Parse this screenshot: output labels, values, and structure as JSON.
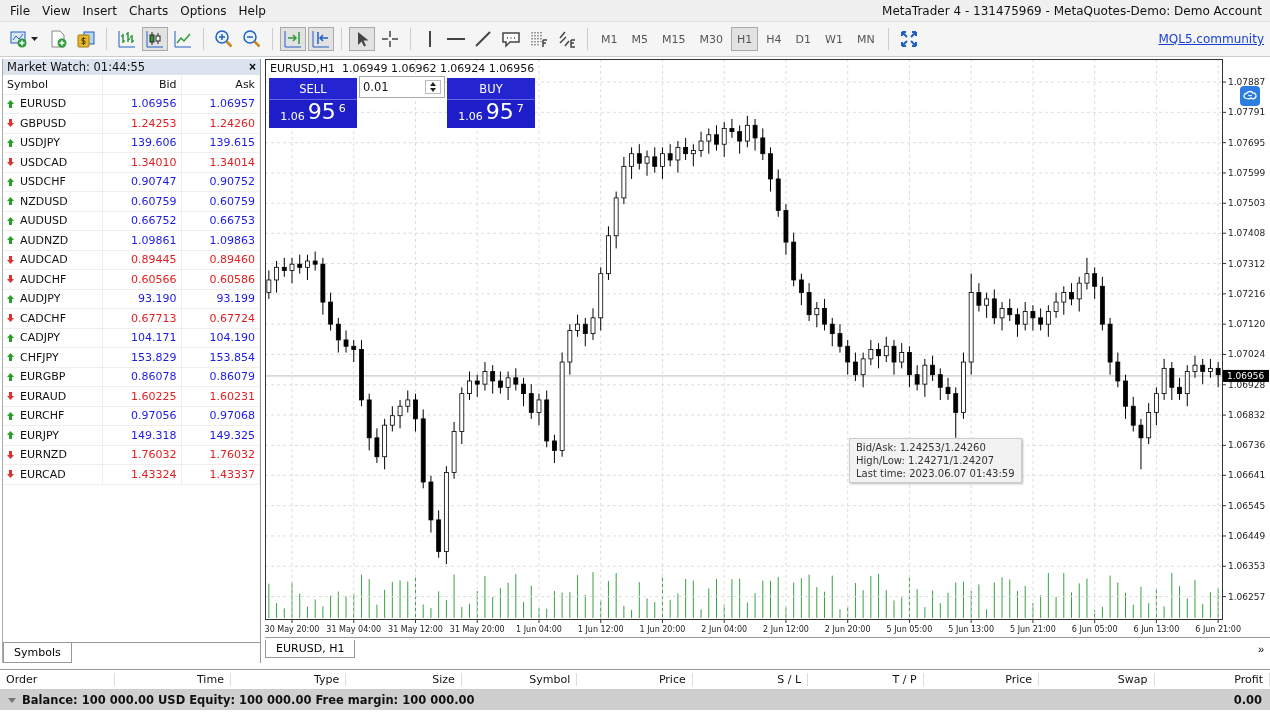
{
  "menu": [
    "File",
    "View",
    "Insert",
    "Charts",
    "Options",
    "Help"
  ],
  "window": {
    "title": "MetaTrader 4 - 131475969 - MetaQuotes-Demo: Demo Account"
  },
  "toolbar": {
    "groups": [
      {
        "tools": [
          {
            "kind": "new-chart",
            "selected": false
          },
          {
            "kind": "new-document",
            "selected": false
          },
          {
            "kind": "dollar-windows",
            "selected": false
          }
        ]
      },
      {
        "tools": [
          {
            "kind": "bar-chart",
            "selected": false
          },
          {
            "kind": "candle-chart",
            "selected": true
          },
          {
            "kind": "line-chart",
            "selected": false
          }
        ]
      },
      {
        "tools": [
          {
            "kind": "zoom-in",
            "selected": false
          },
          {
            "kind": "zoom-out",
            "selected": false
          }
        ]
      },
      {
        "tools": [
          {
            "kind": "auto-scroll",
            "selected": true
          },
          {
            "kind": "chart-shift",
            "selected": true
          }
        ]
      },
      {
        "tools": [
          {
            "kind": "cursor",
            "selected": true
          },
          {
            "kind": "crosshair",
            "selected": false
          }
        ]
      },
      {
        "tools": [
          {
            "kind": "vertical-line",
            "selected": false
          },
          {
            "kind": "horizontal-line",
            "selected": false
          },
          {
            "kind": "trend-line",
            "selected": false
          },
          {
            "kind": "text-label",
            "selected": false
          },
          {
            "kind": "fibonacci",
            "selected": false
          },
          {
            "kind": "fib-expansion",
            "selected": false
          }
        ]
      }
    ],
    "timeframes": [
      {
        "label": "M1",
        "selected": false
      },
      {
        "label": "M5",
        "selected": false
      },
      {
        "label": "M15",
        "selected": false
      },
      {
        "label": "M30",
        "selected": false
      },
      {
        "label": "H1",
        "selected": true
      },
      {
        "label": "H4",
        "selected": false
      },
      {
        "label": "D1",
        "selected": false
      },
      {
        "label": "W1",
        "selected": false
      },
      {
        "label": "MN",
        "selected": false
      }
    ],
    "link": "MQL5.community"
  },
  "market_watch": {
    "title": "Market Watch: 01:44:55",
    "close": "×",
    "columns": [
      "Symbol",
      "Bid",
      "Ask"
    ],
    "rows": [
      {
        "symbol": "EURUSD",
        "bid": "1.06956",
        "ask": "1.06957",
        "rising": true
      },
      {
        "symbol": "GBPUSD",
        "bid": "1.24253",
        "ask": "1.24260",
        "rising": false
      },
      {
        "symbol": "USDJPY",
        "bid": "139.606",
        "ask": "139.615",
        "rising": true
      },
      {
        "symbol": "USDCAD",
        "bid": "1.34010",
        "ask": "1.34014",
        "rising": false
      },
      {
        "symbol": "USDCHF",
        "bid": "0.90747",
        "ask": "0.90752",
        "rising": true
      },
      {
        "symbol": "NZDUSD",
        "bid": "0.60759",
        "ask": "0.60759",
        "rising": true
      },
      {
        "symbol": "AUDUSD",
        "bid": "0.66752",
        "ask": "0.66753",
        "rising": true
      },
      {
        "symbol": "AUDNZD",
        "bid": "1.09861",
        "ask": "1.09863",
        "rising": true
      },
      {
        "symbol": "AUDCAD",
        "bid": "0.89445",
        "ask": "0.89460",
        "rising": false
      },
      {
        "symbol": "AUDCHF",
        "bid": "0.60566",
        "ask": "0.60586",
        "rising": false
      },
      {
        "symbol": "AUDJPY",
        "bid": "93.190",
        "ask": "93.199",
        "rising": true
      },
      {
        "symbol": "CADCHF",
        "bid": "0.67713",
        "ask": "0.67724",
        "rising": false
      },
      {
        "symbol": "CADJPY",
        "bid": "104.171",
        "ask": "104.190",
        "rising": true
      },
      {
        "symbol": "CHFJPY",
        "bid": "153.829",
        "ask": "153.854",
        "rising": true
      },
      {
        "symbol": "EURGBP",
        "bid": "0.86078",
        "ask": "0.86079",
        "rising": true
      },
      {
        "symbol": "EURAUD",
        "bid": "1.60225",
        "ask": "1.60231",
        "rising": false
      },
      {
        "symbol": "EURCHF",
        "bid": "0.97056",
        "ask": "0.97068",
        "rising": true
      },
      {
        "symbol": "EURJPY",
        "bid": "149.318",
        "ask": "149.325",
        "rising": true
      },
      {
        "symbol": "EURNZD",
        "bid": "1.76032",
        "ask": "1.76032",
        "rising": false
      },
      {
        "symbol": "EURCAD",
        "bid": "1.43324",
        "ask": "1.43337",
        "rising": false
      }
    ],
    "tabs": [
      {
        "label": "Symbols",
        "selected": true
      }
    ]
  },
  "chart": {
    "header": "EURUSD,H1  1.06949 1.06962 1.06924 1.06956",
    "trade_panel": {
      "sell": "SELL",
      "buy": "BUY",
      "lot": "0.01",
      "sell_price": [
        "1.06",
        "95",
        "6"
      ],
      "buy_price": [
        "1.06",
        "95",
        "7"
      ]
    },
    "current_price": "1.06956",
    "tooltip": [
      "Bid/Ask: 1.24253/1.24260",
      "High/Low: 1.24271/1.24207",
      "Last time: 2023.06.07 01:43:59"
    ],
    "tabs": [
      {
        "label": "EURUSD, H1",
        "selected": true
      }
    ],
    "more": "»",
    "chart_data": {
      "type": "candlestick",
      "grid": true,
      "categories": [
        null,
        null,
        null,
        "30 May 20:00",
        null,
        null,
        null,
        null,
        null,
        null,
        null,
        "31 May 04:00",
        null,
        null,
        null,
        null,
        null,
        null,
        null,
        "31 May 12:00",
        null,
        null,
        null,
        null,
        null,
        null,
        null,
        "31 May 20:00",
        null,
        null,
        null,
        null,
        null,
        null,
        null,
        "1 Jun 04:00",
        null,
        null,
        null,
        null,
        null,
        null,
        null,
        "1 Jun 12:00",
        null,
        null,
        null,
        null,
        null,
        null,
        null,
        "1 Jun 20:00",
        null,
        null,
        null,
        null,
        null,
        null,
        null,
        "2 Jun 04:00",
        null,
        null,
        null,
        null,
        null,
        null,
        null,
        "2 Jun 12:00",
        null,
        null,
        null,
        null,
        null,
        null,
        null,
        "2 Jun 20:00",
        null,
        null,
        null,
        null,
        null,
        null,
        null,
        "5 Jun 05:00",
        null,
        null,
        null,
        null,
        null,
        null,
        null,
        "5 Jun 13:00",
        null,
        null,
        null,
        null,
        null,
        null,
        null,
        "5 Jun 21:00",
        null,
        null,
        null,
        null,
        null,
        null,
        null,
        "6 Jun 05:00",
        null,
        null,
        null,
        null,
        null,
        null,
        null,
        "6 Jun 13:00",
        null,
        null,
        null,
        null,
        null,
        null,
        null,
        "6 Jun 21:00"
      ],
      "ref_lines": [
        {
          "axis": "y",
          "value": 1.06956
        }
      ],
      "ylim": [
        1.06186,
        1.0796
      ],
      "yticks": [
        {
          "value": 1.07887,
          "label": "1.07887"
        },
        {
          "value": 1.07791,
          "label": "1.07791"
        },
        {
          "value": 1.07695,
          "label": "1.07695"
        },
        {
          "value": 1.07599,
          "label": "1.07599"
        },
        {
          "value": 1.07503,
          "label": "1.07503"
        },
        {
          "value": 1.07408,
          "label": "1.07408"
        },
        {
          "value": 1.07312,
          "label": "1.07312"
        },
        {
          "value": 1.07216,
          "label": "1.07216"
        },
        {
          "value": 1.0712,
          "label": "1.07120"
        },
        {
          "value": 1.07024,
          "label": "1.07024"
        },
        {
          "value": 1.06928,
          "label": "1.06928"
        },
        {
          "value": 1.06832,
          "label": "1.06832"
        },
        {
          "value": 1.06736,
          "label": "1.06736"
        },
        {
          "value": 1.06641,
          "label": "1.06641"
        },
        {
          "value": 1.06545,
          "label": "1.06545"
        },
        {
          "value": 1.06449,
          "label": "1.06449"
        },
        {
          "value": 1.06353,
          "label": "1.06353"
        },
        {
          "value": 1.06257,
          "label": "1.06257"
        }
      ],
      "ohlc": [
        [
          1.0722,
          1.0729,
          1.072,
          1.0726
        ],
        [
          1.0726,
          1.0732,
          1.0722,
          1.073
        ],
        [
          1.073,
          1.0733,
          1.0727,
          1.0729
        ],
        [
          1.0729,
          1.0733,
          1.0725,
          1.0731
        ],
        [
          1.0731,
          1.0734,
          1.0728,
          1.073
        ],
        [
          1.073,
          1.0734,
          1.0726,
          1.0732
        ],
        [
          1.0732,
          1.0735,
          1.0729,
          1.0731
        ],
        [
          1.0731,
          1.0733,
          1.0715,
          1.0719
        ],
        [
          1.0719,
          1.0722,
          1.071,
          1.0712
        ],
        [
          1.0712,
          1.0714,
          1.0703,
          1.0707
        ],
        [
          1.0707,
          1.071,
          1.0703,
          1.0705
        ],
        [
          1.0705,
          1.0707,
          1.07,
          1.0704
        ],
        [
          1.0704,
          1.0707,
          1.0686,
          1.0688
        ],
        [
          1.0688,
          1.069,
          1.0672,
          1.0676
        ],
        [
          1.0676,
          1.0679,
          1.0668,
          1.067
        ],
        [
          1.067,
          1.0682,
          1.0666,
          1.068
        ],
        [
          1.068,
          1.0686,
          1.0678,
          1.0683
        ],
        [
          1.0683,
          1.0688,
          1.0679,
          1.0686
        ],
        [
          1.0686,
          1.0691,
          1.0684,
          1.0688
        ],
        [
          1.0688,
          1.069,
          1.0678,
          1.0682
        ],
        [
          1.0682,
          1.0685,
          1.066,
          1.0662
        ],
        [
          1.0662,
          1.0664,
          1.0646,
          1.065
        ],
        [
          1.065,
          1.0653,
          1.0638,
          1.064
        ],
        [
          1.064,
          1.0667,
          1.0636,
          1.0665
        ],
        [
          1.0665,
          1.0681,
          1.0663,
          1.0678
        ],
        [
          1.0678,
          1.0692,
          1.0674,
          1.069
        ],
        [
          1.069,
          1.0697,
          1.0688,
          1.0694
        ],
        [
          1.0694,
          1.0696,
          1.0689,
          1.0693
        ],
        [
          1.0693,
          1.07,
          1.0691,
          1.0697
        ],
        [
          1.0697,
          1.0699,
          1.069,
          1.0694
        ],
        [
          1.0694,
          1.0697,
          1.069,
          1.0692
        ],
        [
          1.0692,
          1.0697,
          1.0688,
          1.0695
        ],
        [
          1.0695,
          1.0698,
          1.0691,
          1.0693
        ],
        [
          1.0693,
          1.0695,
          1.0686,
          1.069
        ],
        [
          1.069,
          1.0693,
          1.0682,
          1.0684
        ],
        [
          1.0684,
          1.069,
          1.068,
          1.0688
        ],
        [
          1.0688,
          1.0691,
          1.0673,
          1.0675
        ],
        [
          1.0675,
          1.0677,
          1.0668,
          1.0672
        ],
        [
          1.0672,
          1.0703,
          1.067,
          1.07
        ],
        [
          1.07,
          1.0712,
          1.0696,
          1.071
        ],
        [
          1.071,
          1.0715,
          1.0708,
          1.0712
        ],
        [
          1.0712,
          1.0714,
          1.0705,
          1.0709
        ],
        [
          1.0709,
          1.0717,
          1.0707,
          1.0714
        ],
        [
          1.0714,
          1.073,
          1.071,
          1.0728
        ],
        [
          1.0728,
          1.0743,
          1.0726,
          1.074
        ],
        [
          1.074,
          1.0754,
          1.0736,
          1.0752
        ],
        [
          1.0752,
          1.0765,
          1.075,
          1.0762
        ],
        [
          1.0762,
          1.0768,
          1.0758,
          1.0766
        ],
        [
          1.0766,
          1.0769,
          1.0761,
          1.0763
        ],
        [
          1.0763,
          1.0767,
          1.0759,
          1.0765
        ],
        [
          1.0765,
          1.0768,
          1.076,
          1.0762
        ],
        [
          1.0762,
          1.0768,
          1.0758,
          1.0766
        ],
        [
          1.0766,
          1.0769,
          1.0762,
          1.0764
        ],
        [
          1.0764,
          1.077,
          1.076,
          1.0768
        ],
        [
          1.0768,
          1.0771,
          1.0764,
          1.0766
        ],
        [
          1.0766,
          1.0769,
          1.0762,
          1.0767
        ],
        [
          1.0767,
          1.0773,
          1.0765,
          1.077
        ],
        [
          1.077,
          1.0774,
          1.0766,
          1.0772
        ],
        [
          1.0772,
          1.0775,
          1.0767,
          1.0769
        ],
        [
          1.0769,
          1.0776,
          1.0765,
          1.0774
        ],
        [
          1.0774,
          1.0777,
          1.0771,
          1.0773
        ],
        [
          1.0773,
          1.0775,
          1.0766,
          1.077
        ],
        [
          1.077,
          1.0778,
          1.0768,
          1.0775
        ],
        [
          1.0775,
          1.0777,
          1.0767,
          1.0771
        ],
        [
          1.0771,
          1.0774,
          1.0764,
          1.0766
        ],
        [
          1.0766,
          1.0768,
          1.0754,
          1.0758
        ],
        [
          1.0758,
          1.0761,
          1.0746,
          1.0748
        ],
        [
          1.0748,
          1.075,
          1.0734,
          1.0738
        ],
        [
          1.0738,
          1.0741,
          1.0724,
          1.0726
        ],
        [
          1.0726,
          1.0728,
          1.0718,
          1.0722
        ],
        [
          1.0722,
          1.0725,
          1.0713,
          1.0715
        ],
        [
          1.0715,
          1.0719,
          1.0711,
          1.0717
        ],
        [
          1.0717,
          1.072,
          1.071,
          1.0712
        ],
        [
          1.0712,
          1.0714,
          1.0705,
          1.0709
        ],
        [
          1.0709,
          1.0712,
          1.0703,
          1.0705
        ],
        [
          1.0705,
          1.0707,
          1.0696,
          1.07
        ],
        [
          1.07,
          1.0703,
          1.0694,
          1.0696
        ],
        [
          1.0696,
          1.0703,
          1.0692,
          1.0701
        ],
        [
          1.0701,
          1.0707,
          1.0699,
          1.0704
        ],
        [
          1.0704,
          1.0706,
          1.0698,
          1.0702
        ],
        [
          1.0702,
          1.0708,
          1.07,
          1.0705
        ],
        [
          1.0705,
          1.0707,
          1.0696,
          1.07
        ],
        [
          1.07,
          1.0706,
          1.0698,
          1.0703
        ],
        [
          1.0703,
          1.0705,
          1.0692,
          1.0696
        ],
        [
          1.0696,
          1.0699,
          1.0691,
          1.0693
        ],
        [
          1.0693,
          1.0701,
          1.0689,
          1.0699
        ],
        [
          1.0699,
          1.0702,
          1.0694,
          1.0696
        ],
        [
          1.0696,
          1.0698,
          1.0688,
          1.0692
        ],
        [
          1.0692,
          1.0695,
          1.0688,
          1.069
        ],
        [
          1.069,
          1.0692,
          1.0676,
          1.0684
        ],
        [
          1.0684,
          1.0703,
          1.0682,
          1.07
        ],
        [
          1.07,
          1.0728,
          1.0696,
          1.0722
        ],
        [
          1.0722,
          1.0725,
          1.0716,
          1.0718
        ],
        [
          1.0718,
          1.0722,
          1.0714,
          1.072
        ],
        [
          1.072,
          1.0723,
          1.0712,
          1.0714
        ],
        [
          1.0714,
          1.0719,
          1.071,
          1.0717
        ],
        [
          1.0717,
          1.072,
          1.0713,
          1.0715
        ],
        [
          1.0715,
          1.0717,
          1.0708,
          1.0712
        ],
        [
          1.0712,
          1.0719,
          1.071,
          1.0716
        ],
        [
          1.0716,
          1.0718,
          1.071,
          1.0714
        ],
        [
          1.0714,
          1.0717,
          1.071,
          1.0712
        ],
        [
          1.0712,
          1.0718,
          1.0708,
          1.0716
        ],
        [
          1.0716,
          1.0722,
          1.0714,
          1.0719
        ],
        [
          1.0719,
          1.0724,
          1.0715,
          1.0722
        ],
        [
          1.0722,
          1.0725,
          1.0718,
          1.072
        ],
        [
          1.072,
          1.0727,
          1.0716,
          1.0725
        ],
        [
          1.0725,
          1.0733,
          1.0723,
          1.0728
        ],
        [
          1.0728,
          1.073,
          1.072,
          1.0724
        ],
        [
          1.0724,
          1.0727,
          1.071,
          1.0712
        ],
        [
          1.0712,
          1.0714,
          1.0696,
          1.07
        ],
        [
          1.07,
          1.0703,
          1.0692,
          1.0694
        ],
        [
          1.0694,
          1.0696,
          1.0682,
          1.0686
        ],
        [
          1.0686,
          1.0689,
          1.0678,
          1.068
        ],
        [
          1.068,
          1.0682,
          1.0666,
          1.0676
        ],
        [
          1.0676,
          1.0687,
          1.0674,
          1.0684
        ],
        [
          1.0684,
          1.0692,
          1.068,
          1.069
        ],
        [
          1.069,
          1.0701,
          1.0688,
          1.0698
        ],
        [
          1.0698,
          1.07,
          1.0688,
          1.0692
        ],
        [
          1.0692,
          1.0695,
          1.0688,
          1.069
        ],
        [
          1.069,
          1.0699,
          1.0686,
          1.0697
        ],
        [
          1.0697,
          1.0702,
          1.0695,
          1.0699
        ],
        [
          1.0699,
          1.0701,
          1.0693,
          1.0697
        ],
        [
          1.0697,
          1.0701,
          1.0695,
          1.0698
        ],
        [
          1.0698,
          1.07,
          1.0692,
          1.0696
        ]
      ]
    }
  },
  "terminal": {
    "columns": [
      "Order",
      "Time",
      "Type",
      "Size",
      "Symbol",
      "Price",
      "S / L",
      "T / P",
      "Price",
      "Swap",
      "Profit"
    ],
    "balance": "Balance: 100 000.00 USD  Equity: 100 000.00  Free margin: 100 000.00",
    "profit": "0.00"
  }
}
